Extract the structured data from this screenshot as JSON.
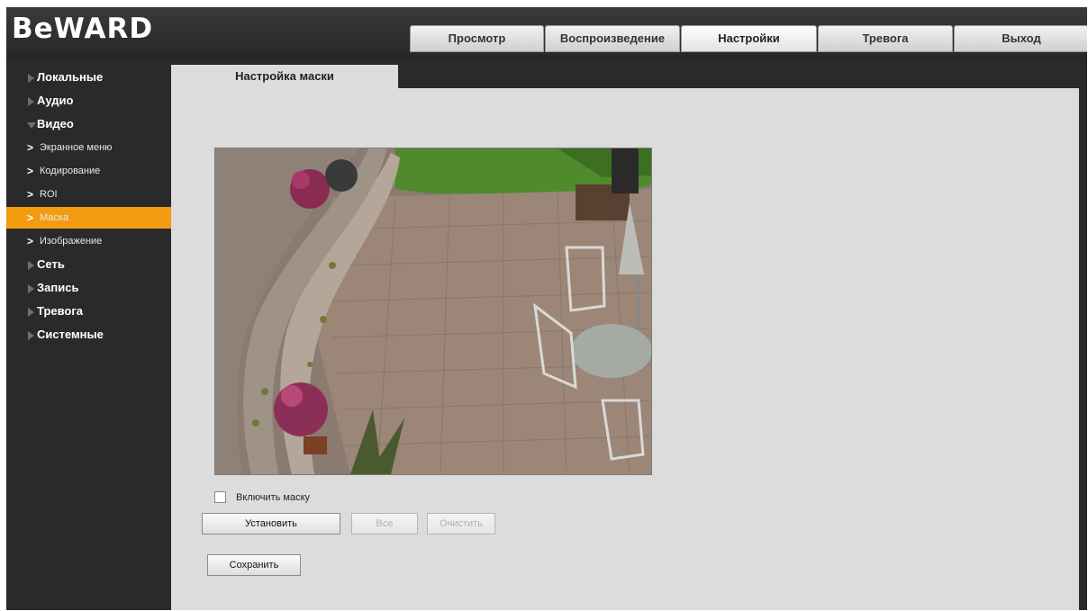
{
  "header": {
    "logo": "BeWARD",
    "tabs": [
      {
        "label": "Просмотр",
        "active": false
      },
      {
        "label": "Воспроизведение",
        "active": false
      },
      {
        "label": "Настройки",
        "active": true
      },
      {
        "label": "Тревога",
        "active": false
      },
      {
        "label": "Выход",
        "active": false
      }
    ]
  },
  "sidebar": {
    "items": [
      {
        "label": "Локальные",
        "expanded": false
      },
      {
        "label": "Аудио",
        "expanded": false
      },
      {
        "label": "Видео",
        "expanded": true
      },
      {
        "label": "Сеть",
        "expanded": false
      },
      {
        "label": "Запись",
        "expanded": false
      },
      {
        "label": "Тревога",
        "expanded": false
      },
      {
        "label": "Системные",
        "expanded": false
      }
    ],
    "video_subitems": [
      {
        "label": "Экранное меню",
        "active": false
      },
      {
        "label": "Кодирование",
        "active": false
      },
      {
        "label": "ROI",
        "active": false
      },
      {
        "label": "Маска",
        "active": true
      },
      {
        "label": "Изображение",
        "active": false
      }
    ],
    "accent_color": "#f39c12"
  },
  "main": {
    "tab_title": "Настройка маски",
    "video_alt": "camera-preview",
    "enable_mask_label": "Включить маску",
    "enable_mask_checked": false,
    "buttons": {
      "set": "Установить",
      "all": "Все",
      "clear": "Очистить",
      "save": "Сохранить"
    }
  }
}
